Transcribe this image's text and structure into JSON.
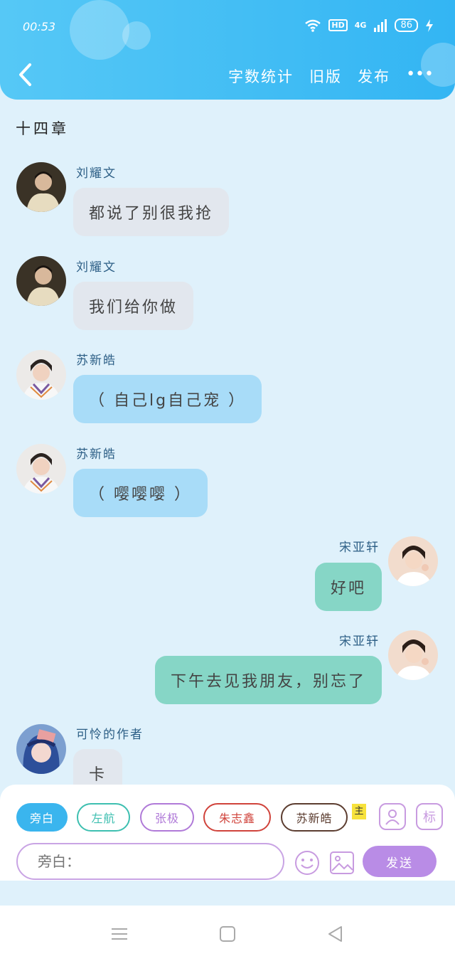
{
  "status_bar": {
    "time": "00:53",
    "network": "4G",
    "hd": "HD",
    "battery": "86"
  },
  "header": {
    "actions": [
      "字数统计",
      "旧版",
      "发布"
    ],
    "more": "•••"
  },
  "chapter_title": "十四章",
  "messages": [
    {
      "sender": "刘耀文",
      "text": "都说了别很我抢",
      "side": "left"
    },
    {
      "sender": "刘耀文",
      "text": "我们给你做",
      "side": "left"
    },
    {
      "sender": "苏新皓",
      "text": "（ 自己lg自己宠 ）",
      "side": "left"
    },
    {
      "sender": "苏新皓",
      "text": "（ 嘤嘤嘤 ）",
      "side": "left"
    },
    {
      "sender": "宋亚轩",
      "text": "好吧",
      "side": "right"
    },
    {
      "sender": "宋亚轩",
      "text": "下午去见我朋友，别忘了",
      "side": "right"
    },
    {
      "sender": "可怜的作者",
      "text": "卡",
      "side": "left"
    }
  ],
  "input": {
    "chips": [
      "旁白",
      "左航",
      "张极",
      "朱志鑫",
      "苏新皓"
    ],
    "main_badge": "主",
    "tag_button": "标",
    "placeholder": "旁白：",
    "send": "发送"
  },
  "colors": {
    "header": "#33b5f3",
    "background": "#dff1fb",
    "bubble_gray": "#e2e7ee",
    "bubble_blue": "#a8dcf8",
    "bubble_teal": "#86d6c6",
    "send": "#b98ce6"
  }
}
